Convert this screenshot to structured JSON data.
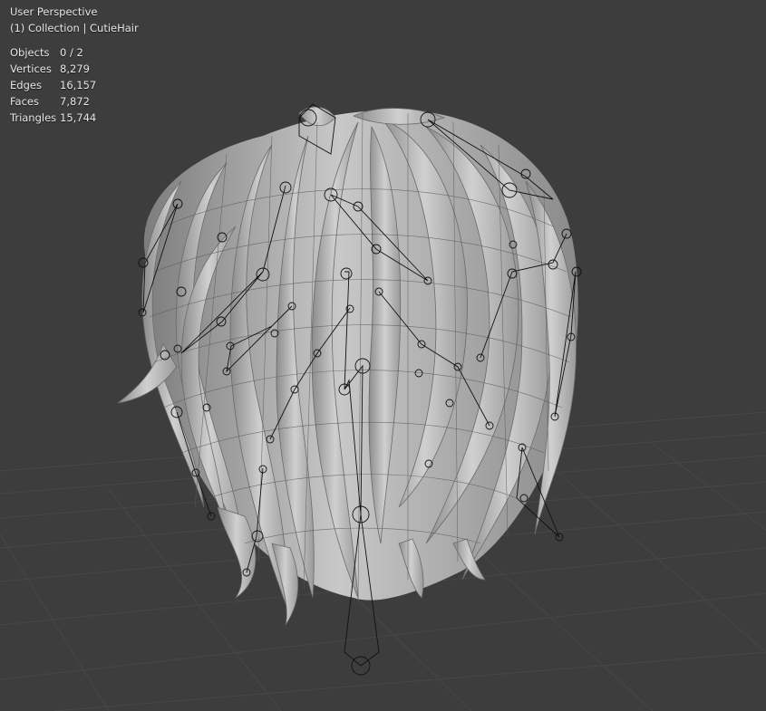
{
  "viewport": {
    "view_name": "User Perspective",
    "collection_line": "(1) Collection | CutieHair",
    "object_name": "CutieHair"
  },
  "stats": [
    {
      "label": "Objects",
      "value": "0 / 2"
    },
    {
      "label": "Vertices",
      "value": "8,279"
    },
    {
      "label": "Edges",
      "value": "16,157"
    },
    {
      "label": "Faces",
      "value": "7,872"
    },
    {
      "label": "Triangles",
      "value": "15,744"
    }
  ],
  "colors": {
    "background": "#3d3d3d",
    "grid": "#474747",
    "mesh": "#9c9c9c",
    "mesh_light": "#c4c4c4",
    "wire": "#4a4a4a",
    "bone": "#111111"
  }
}
